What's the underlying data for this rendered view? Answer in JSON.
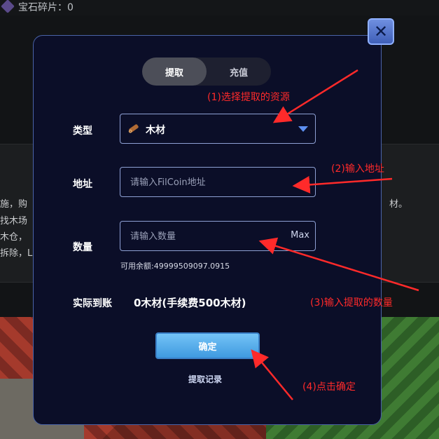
{
  "background": {
    "gem_label": "宝石碎片：0",
    "fragments": [
      "施，购",
      "找木场",
      "木仓，",
      "拆除，L",
      "材。"
    ]
  },
  "close": {
    "symbol": "✕"
  },
  "tabs": [
    {
      "label": "提取",
      "active": true
    },
    {
      "label": "充值",
      "active": false
    }
  ],
  "form": {
    "type": {
      "label": "类型",
      "value": "木材",
      "icon": "wood-log-icon"
    },
    "address": {
      "label": "地址",
      "placeholder": "请输入FilCoin地址",
      "value": ""
    },
    "quantity": {
      "label": "数量",
      "placeholder": "请输入数量",
      "value": "",
      "max_label": "Max"
    },
    "balance": "可用余额:49999509097.0915",
    "received": {
      "label": "实际到账",
      "value": "0木材(手续费500木材)"
    },
    "confirm_label": "确定",
    "history_label": "提取记录"
  },
  "annotations": [
    "(1)选择提取的资源",
    "(2)输入地址",
    "(3)输入提取的数量",
    "(4)点击确定"
  ],
  "colors": {
    "modal_bg": "#0b0e28",
    "modal_border": "#4a63a8",
    "accent_blue": "#5d8ff0",
    "annotation_red": "#ff2a2a"
  }
}
